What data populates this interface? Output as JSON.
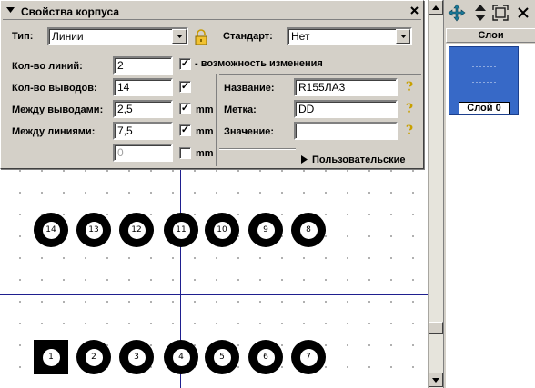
{
  "dialog": {
    "title": "Свойства корпуса",
    "type_label": "Тип:",
    "type_value": "Линии",
    "standard_label": "Стандарт:",
    "standard_value": "Нет",
    "lines_count_label": "Кол-во линий:",
    "lines_count_value": "2",
    "pins_count_label": "Кол-во выводов:",
    "pins_count_value": "14",
    "pin_spacing_label": "Между выводами:",
    "pin_spacing_value": "2,5",
    "line_spacing_label": "Между линиями:",
    "line_spacing_value": "7,5",
    "extra_value": "0",
    "editable_checkbox_label": "- возможность изменения",
    "editable_checked": true,
    "pins_checked": true,
    "pin_spacing_mm_checked": true,
    "line_spacing_mm_checked": true,
    "extra_mm_checked": false,
    "mm_label_1": "mm",
    "mm_label_2": "mm",
    "mm_label_3": "mm",
    "name_label": "Название:",
    "name_value": "R155ЛА3",
    "mark_label": "Метка:",
    "mark_value": "DD",
    "value_label": "Значение:",
    "value_value": "",
    "user_section_label": "Пользовательские"
  },
  "canvas": {
    "top_row_pins": [
      "14",
      "13",
      "12",
      "11",
      "10",
      "9",
      "8"
    ],
    "bottom_row_pins": [
      "1",
      "2",
      "3",
      "4",
      "5",
      "6",
      "7"
    ]
  },
  "layers": {
    "header": "Слои",
    "layer_name": "Слой 0",
    "dots_line": "·······"
  },
  "colors": {
    "dialog_bg": "#d4d0c8",
    "layer_selected": "#3769c7",
    "axis": "#1f1f8f",
    "lock_icon": "#d4a000",
    "move_icon": "#1a7a9a"
  },
  "icons": [
    "move-icon",
    "up-down-arrows-icon",
    "fit-view-icon",
    "close-icon",
    "lock-icon",
    "help-icon",
    "dropdown-arrow-icon",
    "triangle-right-icon"
  ]
}
